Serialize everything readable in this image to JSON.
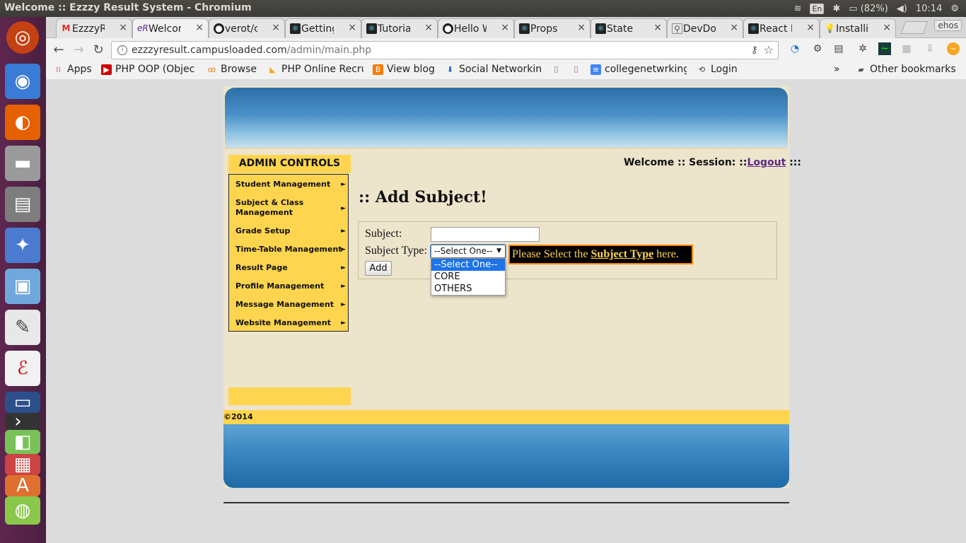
{
  "os": {
    "window_title": "Welcome :: Ezzzy Result System - Chromium",
    "keyboard_layout": "En",
    "battery": "(82%)",
    "clock": "10:14"
  },
  "launcher": {
    "items": [
      "ubuntu-dash-icon",
      "chromium-icon",
      "firefox-icon",
      "disk-icon",
      "files-icon",
      "network-icon",
      "virtualbox-icon",
      "text-editor-icon",
      "document-viewer-icon",
      "presentation-icon",
      "terminal-icon",
      "android-studio-icon",
      "impress-icon",
      "software-center-icon",
      "android-icon"
    ]
  },
  "browser": {
    "tabs": [
      {
        "label": "EzzzyRe",
        "icon": "gmail-icon"
      },
      {
        "label": "Welcom",
        "icon": "ezzzy-icon"
      },
      {
        "label": "verot/c",
        "icon": "github-icon"
      },
      {
        "label": "Getting",
        "icon": "react-icon"
      },
      {
        "label": "Tutoria",
        "icon": "react-icon"
      },
      {
        "label": "Hello W",
        "icon": "github-icon"
      },
      {
        "label": "Props",
        "icon": "react-icon"
      },
      {
        "label": "State",
        "icon": "react-icon"
      },
      {
        "label": "DevDo",
        "icon": "search-icon"
      },
      {
        "label": "React I",
        "icon": "react-icon"
      },
      {
        "label": "Installi",
        "icon": "lightbulb-icon"
      }
    ],
    "profile": "ehos",
    "url_host": "ezzzyresult.campusloaded.com",
    "url_path": "/admin/main.php",
    "bookmarks": [
      {
        "label": "Apps",
        "icon": "apps-grid-icon"
      },
      {
        "label": "PHP OOP (Objec",
        "icon": "youtube-icon"
      },
      {
        "label": "Browse",
        "icon": "browse-icon"
      },
      {
        "label": "PHP Online Recru",
        "icon": "bookmark-icon"
      },
      {
        "label": "View blog",
        "icon": "blogger-icon"
      },
      {
        "label": "Social Networkin",
        "icon": "download-icon"
      },
      {
        "label": "",
        "icon": "page-icon"
      },
      {
        "label": "",
        "icon": "page-icon"
      },
      {
        "label": "collegenetwrking",
        "icon": "doc-icon"
      },
      {
        "label": "Login",
        "icon": "login-icon"
      }
    ],
    "bookmarks_overflow": "»",
    "other_bookmarks": "Other bookmarks"
  },
  "site": {
    "admin_controls": "ADMIN CONTROLS",
    "menu": [
      "Student Management",
      "Subject & Class Management",
      "Grade Setup",
      "Time-Table Management",
      "Result Page",
      "Profile Management",
      "Message Management",
      "Website Management"
    ],
    "welcome_prefix": "Welcome :: Session: ::",
    "logout": "Logout",
    "welcome_suffix": ":::",
    "page_title": ":: Add Subject!",
    "form": {
      "subject_label": "Subject:",
      "subject_value": "",
      "subject_type_label": "Subject Type:",
      "subject_type_selected": "--Select One--",
      "options": [
        "--Select One--",
        "CORE",
        "OTHERS"
      ],
      "add_button": "Add",
      "tooltip_prefix": "Please Select the",
      "tooltip_bold": "Subject Type",
      "tooltip_suffix": "here."
    },
    "footer": "©2014"
  },
  "colors": {
    "accent_yellow": "#ffd54f",
    "page_bg": "#ede4cc",
    "tooltip_border": "#f28500",
    "link_purple": "#5b2a86",
    "dropdown_highlight": "#1e73e8",
    "launcher_bg": "#5e2750"
  }
}
